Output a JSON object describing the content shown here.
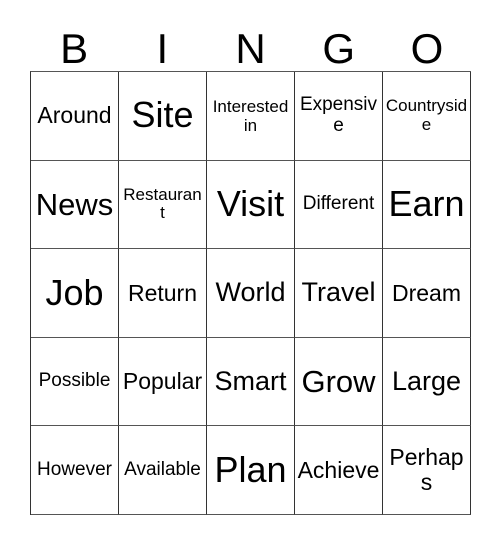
{
  "card": {
    "title": "Bingo Card",
    "headers": [
      "B",
      "I",
      "N",
      "G",
      "O"
    ],
    "grid_color": "#333333",
    "text_color": "#000000",
    "background_color": "#ffffff",
    "rows": 5,
    "columns": 5,
    "cells": [
      [
        {
          "text": "Around",
          "size": "m"
        },
        {
          "text": "Site",
          "size": "xxl"
        },
        {
          "text": "Interested in",
          "size": "xs",
          "wrap": true
        },
        {
          "text": "Expensive",
          "size": "s"
        },
        {
          "text": "Countryside",
          "size": "xs"
        }
      ],
      [
        {
          "text": "News",
          "size": "xl"
        },
        {
          "text": "Restaurant",
          "size": "xs"
        },
        {
          "text": "Visit",
          "size": "xxl"
        },
        {
          "text": "Different",
          "size": "s"
        },
        {
          "text": "Earn",
          "size": "xxl"
        }
      ],
      [
        {
          "text": "Job",
          "size": "xxl"
        },
        {
          "text": "Return",
          "size": "m"
        },
        {
          "text": "World",
          "size": "l"
        },
        {
          "text": "Travel",
          "size": "l"
        },
        {
          "text": "Dream",
          "size": "m"
        }
      ],
      [
        {
          "text": "Possible",
          "size": "s"
        },
        {
          "text": "Popular",
          "size": "m"
        },
        {
          "text": "Smart",
          "size": "l"
        },
        {
          "text": "Grow",
          "size": "xl"
        },
        {
          "text": "Large",
          "size": "l"
        }
      ],
      [
        {
          "text": "However",
          "size": "s"
        },
        {
          "text": "Available",
          "size": "s"
        },
        {
          "text": "Plan",
          "size": "xxl"
        },
        {
          "text": "Achieve",
          "size": "m"
        },
        {
          "text": "Perhaps",
          "size": "m"
        }
      ]
    ]
  }
}
